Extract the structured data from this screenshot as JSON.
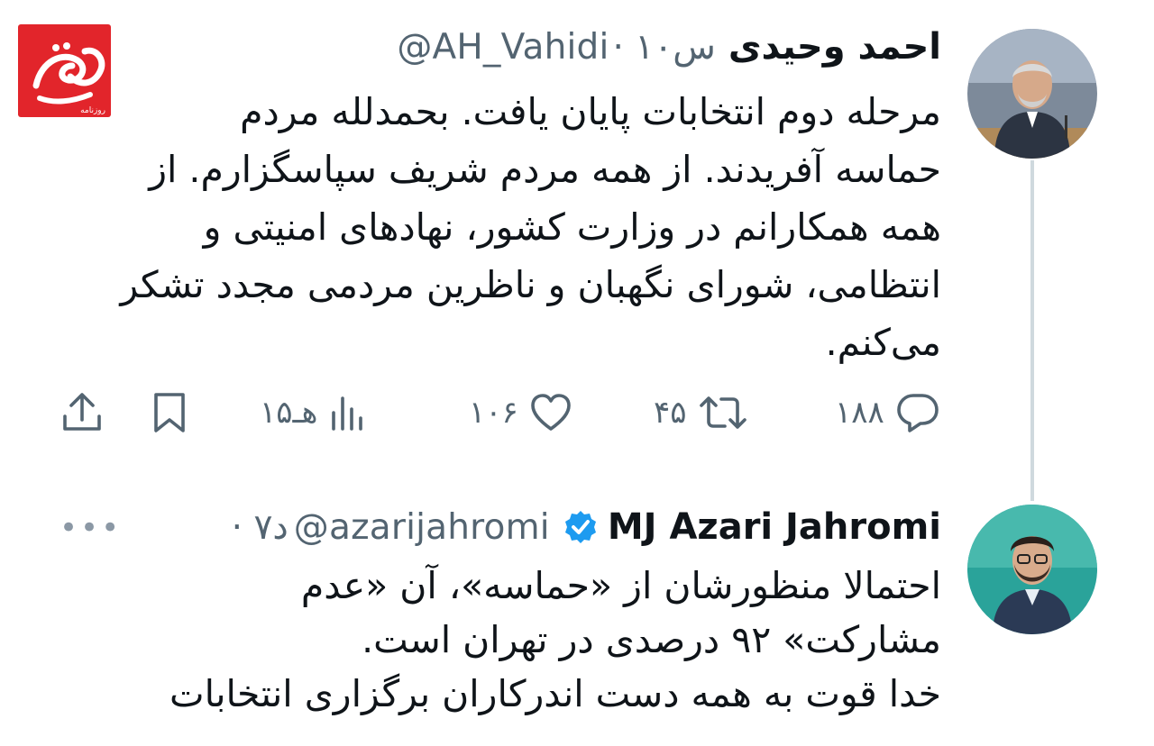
{
  "logo": {
    "name": "roznameh-mihan-logo",
    "text": "میهن",
    "subtext": "روزنامه",
    "color": "#e2252b"
  },
  "tweets": [
    {
      "author_name": "احمد وحیدی",
      "handle": "@AH_Vahidi",
      "time": "· ۱۰س",
      "verified": false,
      "text_lines": [
        "مرحله دوم انتخابات پایان یافت. بحمدلله مردم",
        "حماسه آفریدند. از همه مردم شریف سپاسگزارم. از",
        "همه همکارانم در وزارت کشور، نهادهای امنیتی و",
        "انتظامی، شورای نگهبان و ناظرین مردمی مجدد تشکر",
        "می‌کنم."
      ],
      "actions": {
        "replies": "۱۸۸",
        "retweets": "۴۵",
        "likes": "۱۰۶",
        "views": "۱۵هـ"
      }
    },
    {
      "author_name": "MJ Azari Jahromi",
      "handle": "@azarijahromi",
      "time": "· ۷د",
      "verified": true,
      "more": "•••",
      "text_lines": [
        "احتمالا منظورشان از «حماسه»، آن «عدم",
        "مشارکت» ۹۲ درصدی در تهران است.",
        "خدا قوت به همه دست اندرکاران برگزاری انتخابات"
      ]
    }
  ],
  "colors": {
    "text": "#0f1419",
    "secondary": "#536471",
    "verified": "#1d9bf0",
    "thread_line": "#cfd9de"
  },
  "icons": {
    "reply": "reply-icon",
    "retweet": "retweet-icon",
    "like": "heart-icon",
    "views": "views-icon",
    "bookmark": "bookmark-icon",
    "share": "share-icon",
    "verified": "verified-badge-icon"
  }
}
